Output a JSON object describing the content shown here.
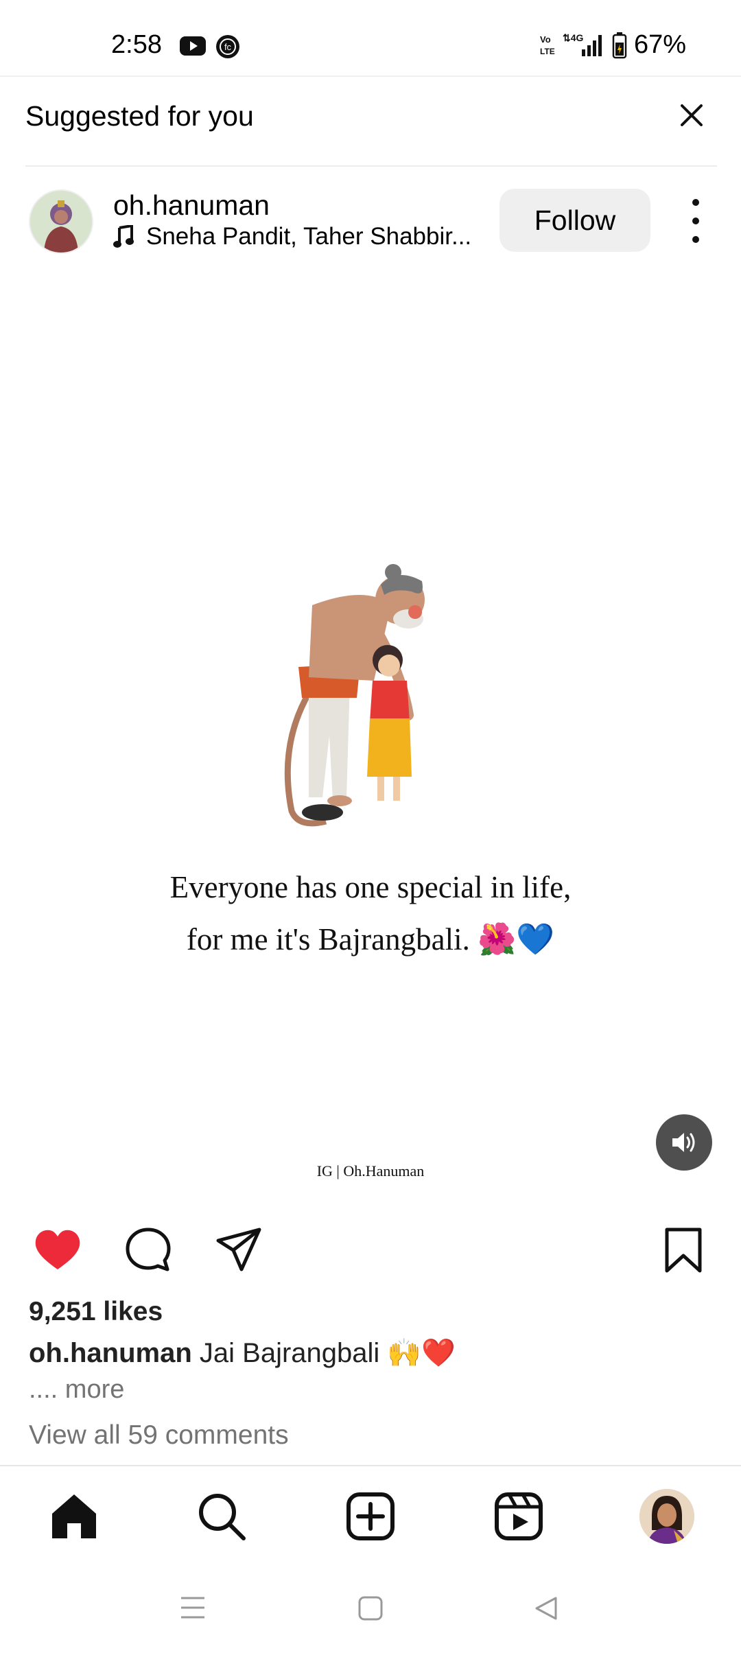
{
  "status_bar": {
    "time": "2:58",
    "battery": "67%",
    "network_label": "4G",
    "volte_label": "Vo LTE",
    "icons": [
      "youtube-icon",
      "fc-app-icon",
      "volte-icon",
      "signal-icon",
      "battery-icon"
    ]
  },
  "header": {
    "title": "Suggested for you",
    "close_icon": "close-icon"
  },
  "post": {
    "username": "oh.hanuman",
    "audio": "Sneha Pandit, Taher Shabbir...",
    "follow_label": "Follow",
    "quote_line1": "Everyone has one special in life,",
    "quote_line2": "for me it's Bajrangbali. 🌺💙",
    "watermark": "IG | Oh.Hanuman",
    "likes": "9,251 likes",
    "caption_user": "oh.hanuman",
    "caption_text": " Jai Bajrangbali 🙌❤️",
    "more": ".... more",
    "view_comments": "View all 59 comments",
    "liked": true,
    "like_color": "#ed2a3a"
  },
  "bottom_nav": {
    "items": [
      "home-icon",
      "search-icon",
      "create-icon",
      "reels-icon",
      "profile-avatar"
    ]
  },
  "system_nav": {
    "items": [
      "menu-icon",
      "home-square-icon",
      "back-icon"
    ]
  }
}
